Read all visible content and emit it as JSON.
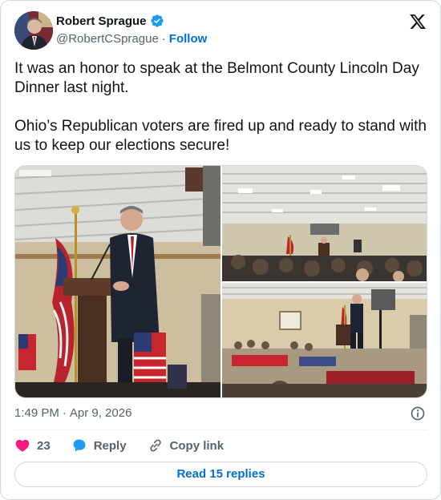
{
  "author": {
    "name": "Robert Sprague",
    "handle": "@RobertCSprague",
    "separator": "·",
    "follow_label": "Follow",
    "verified_color": "#1d9bf0"
  },
  "tweet": {
    "paragraph1": "It was an honor to speak at the Belmont County Lincoln Day Dinner last night.",
    "paragraph2": "Ohio’s Republican voters are fired up and ready to stand with us to keep our elections secure!"
  },
  "meta": {
    "time": "1:49 PM",
    "separator": "·",
    "date": "Apr 9, 2026"
  },
  "actions": {
    "like_count": "23",
    "reply_label": "Reply",
    "copy_label": "Copy link",
    "like_color": "#f91880",
    "reply_color": "#1d9bf0"
  },
  "read_replies_label": "Read 15 replies",
  "icons": {
    "platform": "x-logo-icon",
    "verified": "verified-badge-icon",
    "info": "info-icon",
    "like": "heart-icon",
    "reply": "speech-bubble-icon",
    "copy": "link-icon"
  },
  "accent_color": "#006fd6"
}
